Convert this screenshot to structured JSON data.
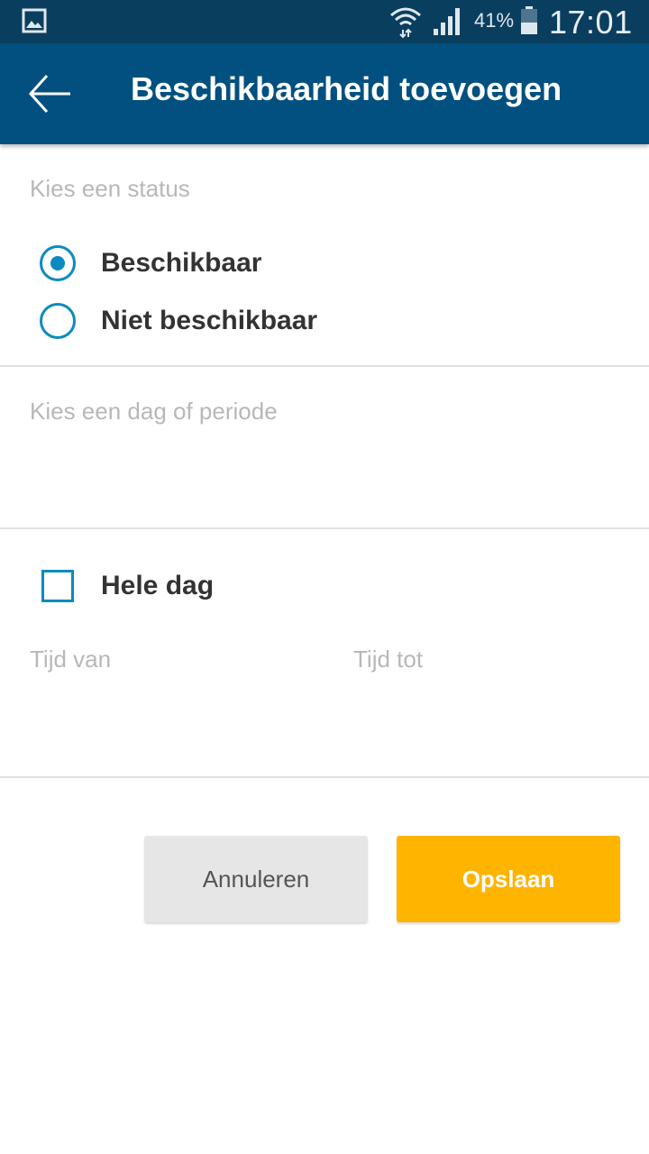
{
  "status_bar": {
    "icons": [
      "gallery-icon",
      "wifi-icon",
      "signal-icon",
      "battery-icon"
    ],
    "battery": "41%",
    "time": "17:01"
  },
  "header": {
    "title": "Beschikbaarheid toevoegen",
    "back_icon": "arrow-left-icon",
    "background": "#01507f"
  },
  "status_section": {
    "label": "Kies een status",
    "options": [
      {
        "label": "Beschikbaar",
        "selected": true
      },
      {
        "label": "Niet beschikbaar",
        "selected": false
      }
    ]
  },
  "period_section": {
    "label": "Kies een dag of periode"
  },
  "time_section": {
    "whole_day_label": "Hele dag",
    "whole_day_checked": false,
    "from_placeholder": "Tijd van",
    "to_placeholder": "Tijd tot"
  },
  "actions": {
    "cancel_label": "Annuleren",
    "save_label": "Opslaan",
    "save_color": "#ffb400",
    "accent_color": "#0a8bc0"
  }
}
